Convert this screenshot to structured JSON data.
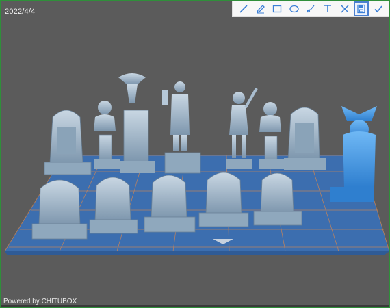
{
  "app": {
    "date_text": "2022/4/4",
    "powered_text": "Powered by CHITUBOX"
  },
  "toolbar": {
    "tools": [
      {
        "name": "line-tool",
        "icon": "line-icon"
      },
      {
        "name": "pen-tool",
        "icon": "pencil-icon"
      },
      {
        "name": "rectangle-tool",
        "icon": "rectangle-icon"
      },
      {
        "name": "ellipse-tool",
        "icon": "ellipse-icon"
      },
      {
        "name": "marker-tool",
        "icon": "brush-icon"
      },
      {
        "name": "text-tool",
        "icon": "text-icon"
      },
      {
        "name": "clear-tool",
        "icon": "cross-icon"
      },
      {
        "name": "save-tool",
        "icon": "save-icon"
      },
      {
        "name": "confirm-tool",
        "icon": "check-icon"
      }
    ],
    "active_tool": "save-tool"
  },
  "colors": {
    "background": "#5b5b5b",
    "platform": "#3d6fb0",
    "grid": "#e0894a",
    "model": "#9fb7cc",
    "selected_model": "#3f97e6",
    "toolbar_icon": "#3b7fd6"
  },
  "scene": {
    "models": [
      {
        "name": "tall-tombstone-left"
      },
      {
        "name": "bust-on-pedestal-left"
      },
      {
        "name": "eagle-urn-pillar"
      },
      {
        "name": "lantern-figure"
      },
      {
        "name": "dancing-figure"
      },
      {
        "name": "bust-on-pedestal-right"
      },
      {
        "name": "tall-tombstone-right"
      },
      {
        "name": "winged-gargoyle",
        "selected": true
      },
      {
        "name": "gravestone-1"
      },
      {
        "name": "gravestone-2"
      },
      {
        "name": "gravestone-3"
      },
      {
        "name": "gravestone-4"
      },
      {
        "name": "gravestone-5"
      }
    ]
  }
}
